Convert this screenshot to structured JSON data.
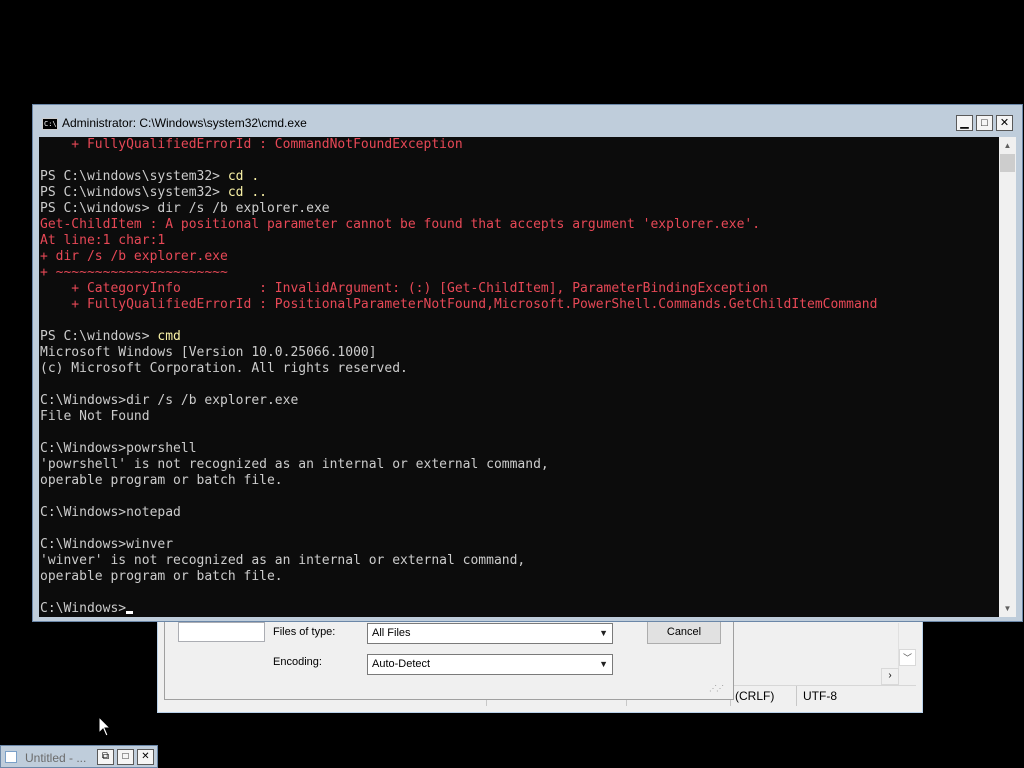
{
  "cmd": {
    "title": "Administrator: C:\\Windows\\system32\\cmd.exe",
    "icon": "cmd-app-icon",
    "lines": [
      {
        "segments": [
          {
            "t": "    + FullyQualifiedErrorId : CommandNotFoundException",
            "c": "red"
          }
        ]
      },
      {
        "segments": [
          {
            "t": "",
            "c": ""
          }
        ]
      },
      {
        "segments": [
          {
            "t": "PS C:\\windows\\system32> ",
            "c": ""
          },
          {
            "t": "cd .",
            "c": "yel"
          }
        ]
      },
      {
        "segments": [
          {
            "t": "PS C:\\windows\\system32> ",
            "c": ""
          },
          {
            "t": "cd ..",
            "c": "yel"
          }
        ]
      },
      {
        "segments": [
          {
            "t": "PS C:\\windows> ",
            "c": ""
          },
          {
            "t": "dir /s /b explorer.exe",
            "c": ""
          }
        ]
      },
      {
        "segments": [
          {
            "t": "Get-ChildItem : A positional parameter cannot be found that accepts argument 'explorer.exe'.",
            "c": "red"
          }
        ]
      },
      {
        "segments": [
          {
            "t": "At line:1 char:1",
            "c": "red"
          }
        ]
      },
      {
        "segments": [
          {
            "t": "+ dir /s /b explorer.exe",
            "c": "red"
          }
        ]
      },
      {
        "segments": [
          {
            "t": "+ ~~~~~~~~~~~~~~~~~~~~~~",
            "c": "red"
          }
        ]
      },
      {
        "segments": [
          {
            "t": "    + CategoryInfo          : InvalidArgument: (:) [Get-ChildItem], ParameterBindingException",
            "c": "red"
          }
        ]
      },
      {
        "segments": [
          {
            "t": "    + FullyQualifiedErrorId : PositionalParameterNotFound,Microsoft.PowerShell.Commands.GetChildItemCommand",
            "c": "red"
          }
        ]
      },
      {
        "segments": [
          {
            "t": "",
            "c": ""
          }
        ]
      },
      {
        "segments": [
          {
            "t": "PS C:\\windows> ",
            "c": ""
          },
          {
            "t": "cmd",
            "c": "yel"
          }
        ]
      },
      {
        "segments": [
          {
            "t": "Microsoft Windows [Version 10.0.25066.1000]",
            "c": ""
          }
        ]
      },
      {
        "segments": [
          {
            "t": "(c) Microsoft Corporation. All rights reserved.",
            "c": ""
          }
        ]
      },
      {
        "segments": [
          {
            "t": "",
            "c": ""
          }
        ]
      },
      {
        "segments": [
          {
            "t": "C:\\Windows>dir /s /b explorer.exe",
            "c": ""
          }
        ]
      },
      {
        "segments": [
          {
            "t": "File Not Found",
            "c": ""
          }
        ]
      },
      {
        "segments": [
          {
            "t": "",
            "c": ""
          }
        ]
      },
      {
        "segments": [
          {
            "t": "C:\\Windows>powrshell",
            "c": ""
          }
        ]
      },
      {
        "segments": [
          {
            "t": "'powrshell' is not recognized as an internal or external command,",
            "c": ""
          }
        ]
      },
      {
        "segments": [
          {
            "t": "operable program or batch file.",
            "c": ""
          }
        ]
      },
      {
        "segments": [
          {
            "t": "",
            "c": ""
          }
        ]
      },
      {
        "segments": [
          {
            "t": "C:\\Windows>notepad",
            "c": ""
          }
        ]
      },
      {
        "segments": [
          {
            "t": "",
            "c": ""
          }
        ]
      },
      {
        "segments": [
          {
            "t": "C:\\Windows>winver",
            "c": ""
          }
        ]
      },
      {
        "segments": [
          {
            "t": "'winver' is not recognized as an internal or external command,",
            "c": ""
          }
        ]
      },
      {
        "segments": [
          {
            "t": "operable program or batch file.",
            "c": ""
          }
        ]
      },
      {
        "segments": [
          {
            "t": "",
            "c": ""
          }
        ]
      },
      {
        "segments": [
          {
            "t": "C:\\Windows>",
            "c": ""
          }
        ],
        "cursor": true
      }
    ],
    "controls": {
      "minimize": "▁",
      "maximize": "□",
      "close": "✕"
    }
  },
  "dialog": {
    "files_of_type_label": "Files of type:",
    "files_of_type_value": "All Files",
    "encoding_label": "Encoding:",
    "encoding_value": "Auto-Detect",
    "cancel_label": "Cancel"
  },
  "notepad": {
    "status_line_ending": "(CRLF)",
    "status_encoding": "UTF-8"
  },
  "taskbar_window": {
    "title": "Untitled - ...",
    "restore": "⧉",
    "maximize": "□",
    "close": "✕"
  }
}
